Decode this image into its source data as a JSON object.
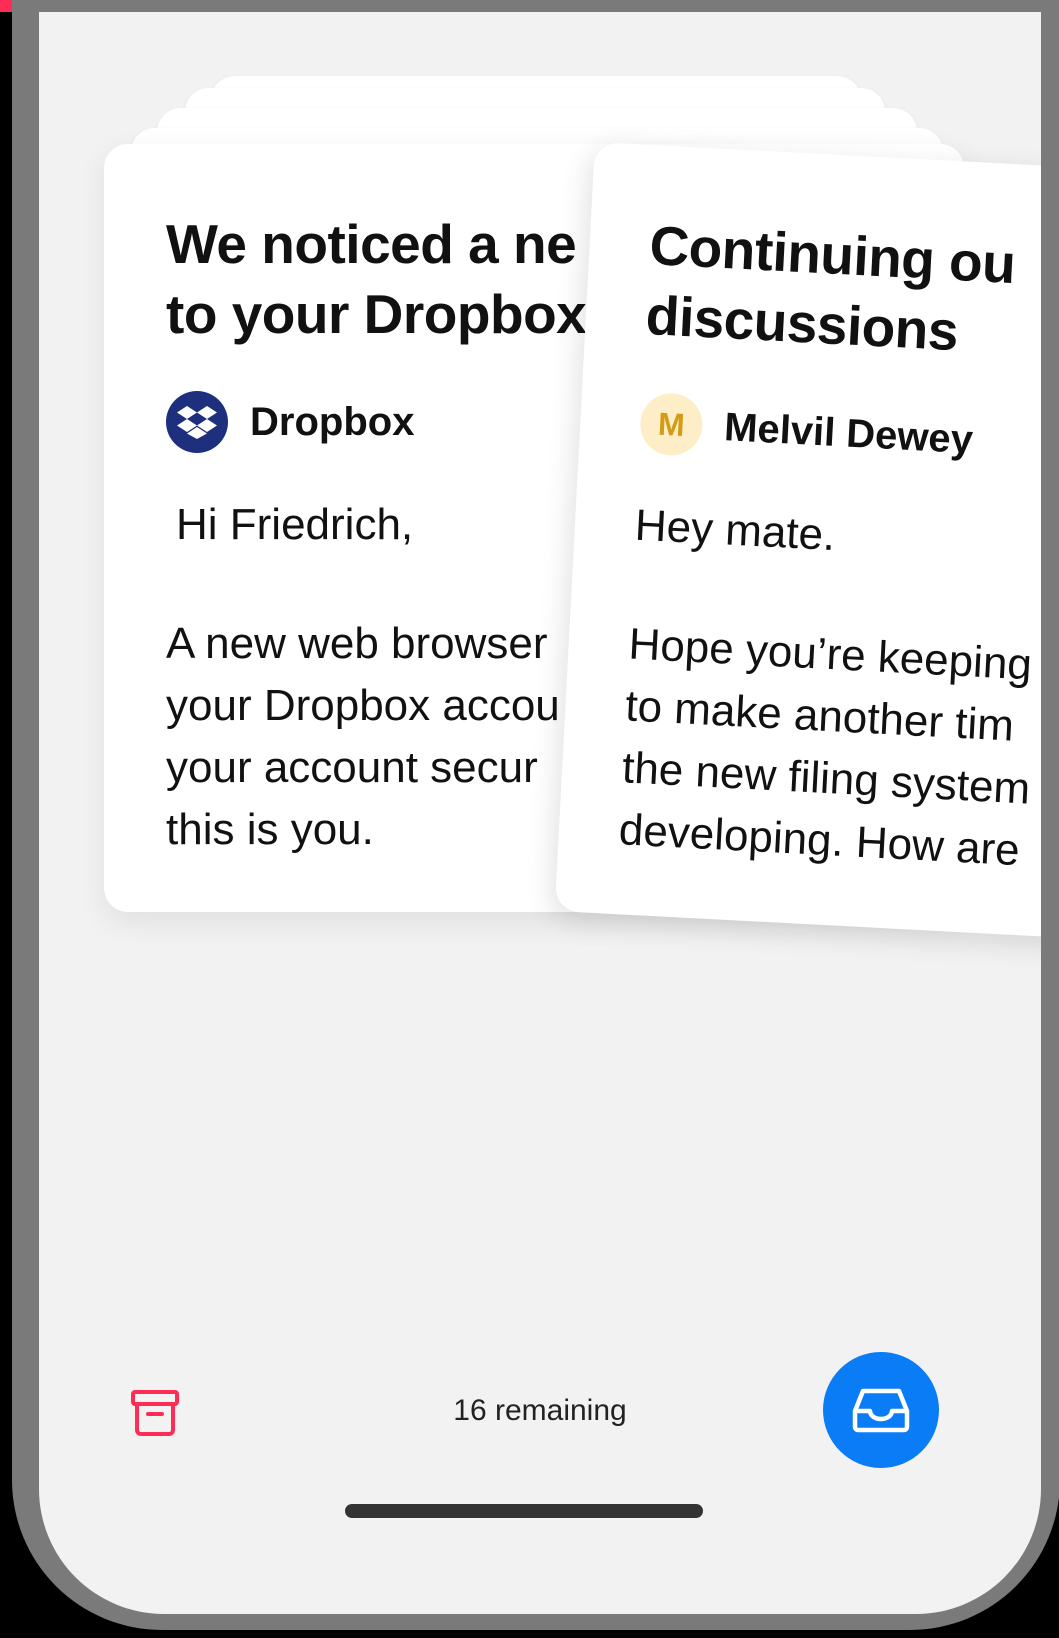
{
  "colors": {
    "accent": "#ff2d55",
    "primary_button": "#0a7cf5",
    "dropbox_avatar": "#1e2f7d",
    "m_avatar_bg": "#fdeec7",
    "m_avatar_fg": "#d39b16"
  },
  "cards": {
    "back": {
      "title_line1": "We noticed a ne",
      "title_line2": "to your Dropbox",
      "sender": "Dropbox",
      "sender_icon": "dropbox-logo-icon",
      "greeting": "Hi Friedrich,",
      "body_lines": [
        "A new web browser",
        "your Dropbox accou",
        "your account secur",
        "this is you."
      ]
    },
    "front": {
      "title_line1": "Continuing ou",
      "title_line2": "discussions",
      "sender": "Melvil Dewey",
      "avatar_initial": "M",
      "greeting": "Hey mate.",
      "body_lines": [
        "Hope you’re keeping",
        "to make another tim",
        "the new filing system",
        "developing. How are"
      ]
    }
  },
  "footer": {
    "remaining_text": "16 remaining",
    "archive_icon": "archive-box-icon",
    "inbox_icon": "inbox-tray-icon"
  }
}
